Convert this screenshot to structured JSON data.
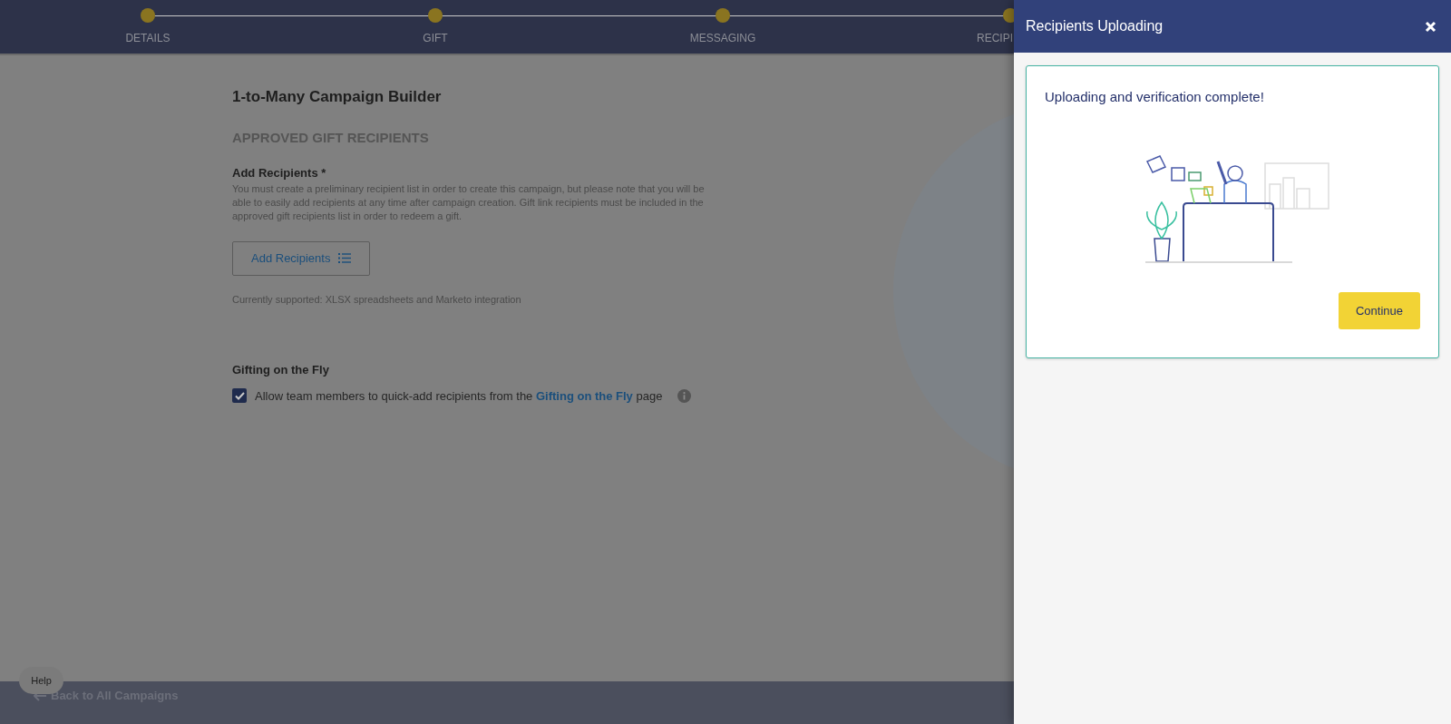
{
  "stepper": [
    {
      "label": "DETAILS",
      "cut": false
    },
    {
      "label": "GIFT",
      "cut": false
    },
    {
      "label": "MESSAGING",
      "cut": false
    },
    {
      "label": "RECIPI",
      "cut": true
    }
  ],
  "page": {
    "title": "1-to-Many Campaign Builder",
    "section": "APPROVED GIFT RECIPIENTS",
    "field_label": "Add Recipients *",
    "description": "You must create a preliminary recipient list in order to create this campaign, but please note that you will be able to easily add recipients at any time after campaign creation. Gift link recipients must be included in the approved gift recipients list in order to redeem a gift.",
    "add_button": "Add Recipients",
    "supported": "Currently supported: XLSX spreadsheets and Marketo integration",
    "gifting_heading": "Gifting on the Fly",
    "checkbox": {
      "checked": true,
      "text_before": "Allow team members to quick-add recipients from the",
      "link": "Gifting on the Fly",
      "text_after": "page"
    }
  },
  "footer": {
    "back_link": "Back to All Campaigns",
    "help": "Help"
  },
  "panel": {
    "title": "Recipients Uploading",
    "message": "Uploading and verification complete!",
    "button": "Continue"
  }
}
